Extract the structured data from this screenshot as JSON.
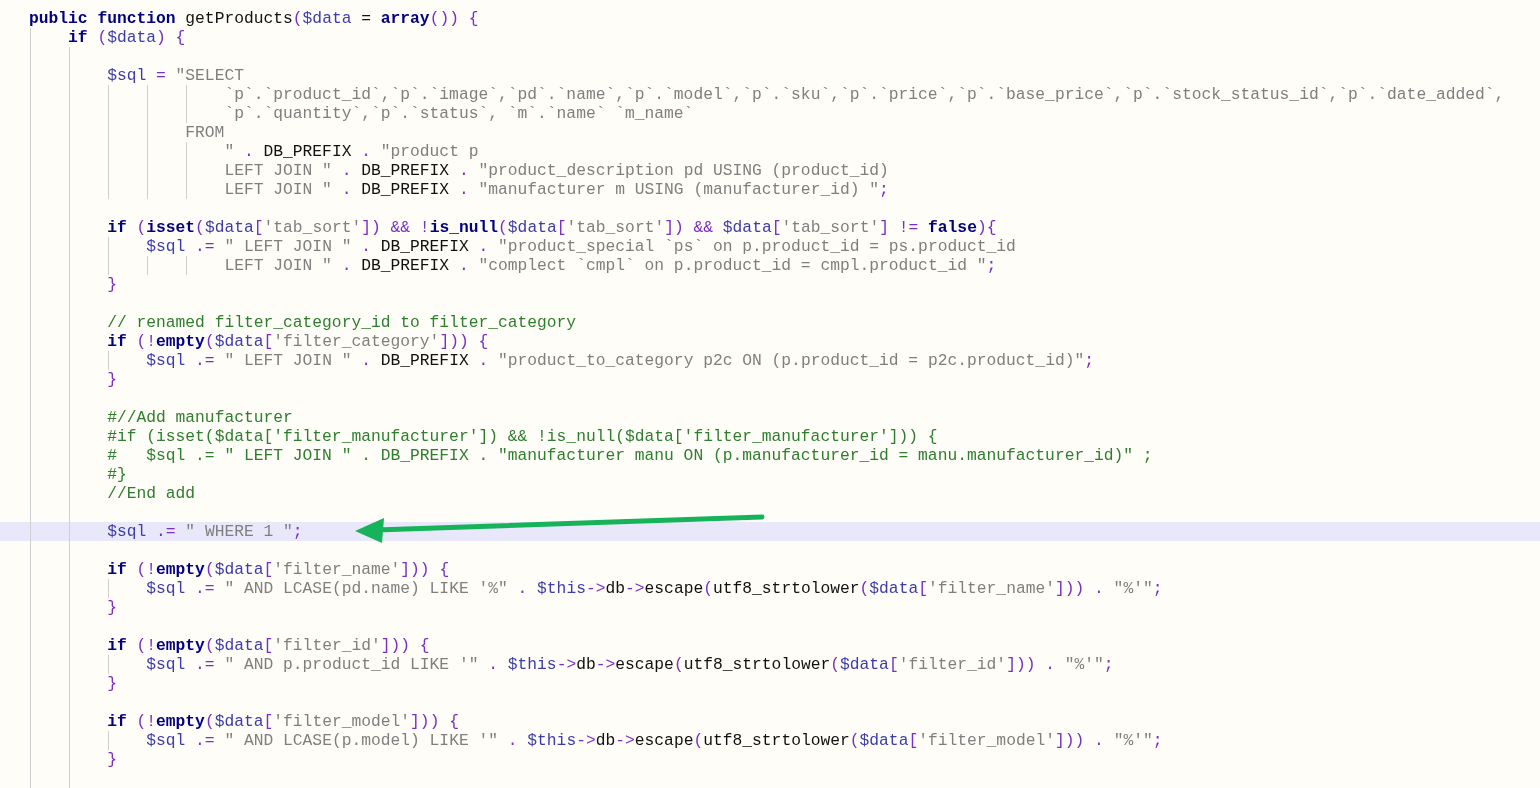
{
  "editor": {
    "lines": [
      {
        "highlighted": false,
        "tokens": [
          {
            "kind": "keyword",
            "text": "public function"
          },
          {
            "kind": "plain",
            "text": " getProducts"
          },
          {
            "kind": "operator",
            "text": "("
          },
          {
            "kind": "variable",
            "text": "$data"
          },
          {
            "kind": "plain",
            "text": " = "
          },
          {
            "kind": "keyword",
            "text": "array"
          },
          {
            "kind": "operator",
            "text": "()) {"
          }
        ],
        "children": [
          {
            "highlighted": false,
            "tokens": [
              {
                "kind": "keyword",
                "text": "if"
              },
              {
                "kind": "operator",
                "text": " ("
              },
              {
                "kind": "variable",
                "text": "$data"
              },
              {
                "kind": "operator",
                "text": ") {"
              }
            ],
            "children": [
              {
                "highlighted": false
              },
              {
                "highlighted": false,
                "tokens": [
                  {
                    "kind": "variable",
                    "text": "$sql"
                  },
                  {
                    "kind": "operator",
                    "text": " = "
                  },
                  {
                    "kind": "string",
                    "text": "\"SELECT"
                  }
                ],
                "children": [
                  {
                    "kind": "wrapped",
                    "highlighted": false,
                    "tokens": [
                      {
                        "kind": "string",
                        "text": "`p`.`product_id`,`p`.`image`,`pd`.`name`,`p`.`model`,`p`.`sku`,`p`.`price`,`p`.`base_price`,`p`.`stock_status_id`,`p`.`date_added`,"
                      }
                    ]
                  },
                  {
                    "kind": "wrapped",
                    "highlighted": false,
                    "tokens": [
                      {
                        "kind": "string",
                        "text": "`p`.`quantity`,`p`.`status`, `m`.`name` `m_name`"
                      }
                    ]
                  },
                  {
                    "kind": "clause",
                    "highlighted": false,
                    "tokens": [
                      {
                        "kind": "string",
                        "text": "FROM"
                      }
                    ]
                  },
                  {
                    "kind": "wrapped",
                    "highlighted": false,
                    "tokens": [
                      {
                        "kind": "string",
                        "text": "\""
                      },
                      {
                        "kind": "operator",
                        "text": " . "
                      },
                      {
                        "kind": "constant",
                        "text": "DB_PREFIX"
                      },
                      {
                        "kind": "operator",
                        "text": " . "
                      },
                      {
                        "kind": "string",
                        "text": "\"product p"
                      }
                    ]
                  },
                  {
                    "kind": "wrapped",
                    "highlighted": false,
                    "tokens": [
                      {
                        "kind": "string",
                        "text": "LEFT JOIN \""
                      },
                      {
                        "kind": "operator",
                        "text": " . "
                      },
                      {
                        "kind": "constant",
                        "text": "DB_PREFIX"
                      },
                      {
                        "kind": "operator",
                        "text": " . "
                      },
                      {
                        "kind": "string",
                        "text": "\"product_description pd USING (product_id)"
                      }
                    ]
                  },
                  {
                    "kind": "wrapped",
                    "highlighted": false,
                    "tokens": [
                      {
                        "kind": "string",
                        "text": "LEFT JOIN \""
                      },
                      {
                        "kind": "operator",
                        "text": " . "
                      },
                      {
                        "kind": "constant",
                        "text": "DB_PREFIX"
                      },
                      {
                        "kind": "operator",
                        "text": " . "
                      },
                      {
                        "kind": "string",
                        "text": "\"manufacturer m USING (manufacturer_id) \""
                      },
                      {
                        "kind": "operator",
                        "text": ";"
                      }
                    ]
                  }
                ]
              },
              {
                "highlighted": false
              },
              {
                "highlighted": false,
                "tokens": [
                  {
                    "kind": "keyword",
                    "text": "if"
                  },
                  {
                    "kind": "operator",
                    "text": " ("
                  },
                  {
                    "kind": "keyword",
                    "text": "isset"
                  },
                  {
                    "kind": "operator",
                    "text": "("
                  },
                  {
                    "kind": "variable",
                    "text": "$data"
                  },
                  {
                    "kind": "operator",
                    "text": "["
                  },
                  {
                    "kind": "string",
                    "text": "'tab_sort'"
                  },
                  {
                    "kind": "operator",
                    "text": "]) && !"
                  },
                  {
                    "kind": "keyword",
                    "text": "is_null"
                  },
                  {
                    "kind": "operator",
                    "text": "("
                  },
                  {
                    "kind": "variable",
                    "text": "$data"
                  },
                  {
                    "kind": "operator",
                    "text": "["
                  },
                  {
                    "kind": "string",
                    "text": "'tab_sort'"
                  },
                  {
                    "kind": "operator",
                    "text": "]) && "
                  },
                  {
                    "kind": "variable",
                    "text": "$data"
                  },
                  {
                    "kind": "operator",
                    "text": "["
                  },
                  {
                    "kind": "string",
                    "text": "'tab_sort'"
                  },
                  {
                    "kind": "operator",
                    "text": "] != "
                  },
                  {
                    "kind": "keyword",
                    "text": "false"
                  },
                  {
                    "kind": "operator",
                    "text": "){"
                  }
                ],
                "children": [
                  {
                    "highlighted": false,
                    "tokens": [
                      {
                        "kind": "variable",
                        "text": "$sql"
                      },
                      {
                        "kind": "operator",
                        "text": " .= "
                      },
                      {
                        "kind": "string",
                        "text": "\" LEFT JOIN \""
                      },
                      {
                        "kind": "operator",
                        "text": " . "
                      },
                      {
                        "kind": "constant",
                        "text": "DB_PREFIX"
                      },
                      {
                        "kind": "operator",
                        "text": " . "
                      },
                      {
                        "kind": "string",
                        "text": "\"product_special `ps` on p.product_id = ps.product_id"
                      }
                    ],
                    "children": [
                      {
                        "kind": "wrapped",
                        "highlighted": false,
                        "tokens": [
                          {
                            "kind": "string",
                            "text": "LEFT JOIN \""
                          },
                          {
                            "kind": "operator",
                            "text": " . "
                          },
                          {
                            "kind": "constant",
                            "text": "DB_PREFIX"
                          },
                          {
                            "kind": "operator",
                            "text": " . "
                          },
                          {
                            "kind": "string",
                            "text": "\"complect `cmpl` on p.product_id = cmpl.product_id \""
                          },
                          {
                            "kind": "operator",
                            "text": ";"
                          }
                        ]
                      }
                    ]
                  }
                ]
              },
              {
                "highlighted": false,
                "tokens": [
                  {
                    "kind": "operator",
                    "text": "}"
                  }
                ]
              },
              {
                "highlighted": false
              },
              {
                "highlighted": false,
                "tokens": [
                  {
                    "kind": "comment",
                    "text": "// renamed filter_category_id to filter_category"
                  }
                ]
              },
              {
                "highlighted": false,
                "tokens": [
                  {
                    "kind": "keyword",
                    "text": "if"
                  },
                  {
                    "kind": "operator",
                    "text": " (!"
                  },
                  {
                    "kind": "keyword",
                    "text": "empty"
                  },
                  {
                    "kind": "operator",
                    "text": "("
                  },
                  {
                    "kind": "variable",
                    "text": "$data"
                  },
                  {
                    "kind": "operator",
                    "text": "["
                  },
                  {
                    "kind": "string",
                    "text": "'filter_category'"
                  },
                  {
                    "kind": "operator",
                    "text": "])) {"
                  }
                ],
                "children": [
                  {
                    "highlighted": false,
                    "tokens": [
                      {
                        "kind": "variable",
                        "text": "$sql"
                      },
                      {
                        "kind": "operator",
                        "text": " .= "
                      },
                      {
                        "kind": "string",
                        "text": "\" LEFT JOIN \""
                      },
                      {
                        "kind": "operator",
                        "text": " . "
                      },
                      {
                        "kind": "constant",
                        "text": "DB_PREFIX"
                      },
                      {
                        "kind": "operator",
                        "text": " . "
                      },
                      {
                        "kind": "string",
                        "text": "\"product_to_category p2c ON (p.product_id = p2c.product_id)\""
                      },
                      {
                        "kind": "operator",
                        "text": ";"
                      }
                    ]
                  }
                ]
              },
              {
                "highlighted": false,
                "tokens": [
                  {
                    "kind": "operator",
                    "text": "}"
                  }
                ]
              },
              {
                "highlighted": false
              },
              {
                "highlighted": false,
                "tokens": [
                  {
                    "kind": "comment",
                    "text": "#//Add manufacturer"
                  }
                ]
              },
              {
                "highlighted": false,
                "tokens": [
                  {
                    "kind": "comment",
                    "text": "#if (isset($data['filter_manufacturer']) && !is_null($data['filter_manufacturer'])) {"
                  }
                ]
              },
              {
                "highlighted": false,
                "tokens": [
                  {
                    "kind": "comment",
                    "text": "#   $sql .= \" LEFT JOIN \" . DB_PREFIX . \"manufacturer manu ON (p.manufacturer_id = manu.manufacturer_id)\" ;"
                  }
                ]
              },
              {
                "highlighted": false,
                "tokens": [
                  {
                    "kind": "comment",
                    "text": "#}"
                  }
                ]
              },
              {
                "highlighted": false,
                "tokens": [
                  {
                    "kind": "comment",
                    "text": "//End add"
                  }
                ]
              },
              {
                "highlighted": false
              },
              {
                "highlighted": true,
                "tokens": [
                  {
                    "kind": "variable",
                    "text": "$sql"
                  },
                  {
                    "kind": "operator",
                    "text": " .= "
                  },
                  {
                    "kind": "string",
                    "text": "\" WHERE 1 \""
                  },
                  {
                    "kind": "operator",
                    "text": ";"
                  }
                ]
              },
              {
                "highlighted": false
              },
              {
                "highlighted": false,
                "tokens": [
                  {
                    "kind": "keyword",
                    "text": "if"
                  },
                  {
                    "kind": "operator",
                    "text": " (!"
                  },
                  {
                    "kind": "keyword",
                    "text": "empty"
                  },
                  {
                    "kind": "operator",
                    "text": "("
                  },
                  {
                    "kind": "variable",
                    "text": "$data"
                  },
                  {
                    "kind": "operator",
                    "text": "["
                  },
                  {
                    "kind": "string",
                    "text": "'filter_name'"
                  },
                  {
                    "kind": "operator",
                    "text": "])) {"
                  }
                ],
                "children": [
                  {
                    "highlighted": false,
                    "tokens": [
                      {
                        "kind": "variable",
                        "text": "$sql"
                      },
                      {
                        "kind": "operator",
                        "text": " .= "
                      },
                      {
                        "kind": "string",
                        "text": "\" AND LCASE(pd.name) LIKE '%\""
                      },
                      {
                        "kind": "operator",
                        "text": " . "
                      },
                      {
                        "kind": "variable",
                        "text": "$this"
                      },
                      {
                        "kind": "operator",
                        "text": "->"
                      },
                      {
                        "kind": "constant",
                        "text": "db"
                      },
                      {
                        "kind": "operator",
                        "text": "->"
                      },
                      {
                        "kind": "constant",
                        "text": "escape"
                      },
                      {
                        "kind": "operator",
                        "text": "("
                      },
                      {
                        "kind": "constant",
                        "text": "utf8_strtolower"
                      },
                      {
                        "kind": "operator",
                        "text": "("
                      },
                      {
                        "kind": "variable",
                        "text": "$data"
                      },
                      {
                        "kind": "operator",
                        "text": "["
                      },
                      {
                        "kind": "string",
                        "text": "'filter_name'"
                      },
                      {
                        "kind": "operator",
                        "text": "])) . "
                      },
                      {
                        "kind": "string",
                        "text": "\"%'\""
                      },
                      {
                        "kind": "operator",
                        "text": ";"
                      }
                    ]
                  }
                ]
              },
              {
                "highlighted": false,
                "tokens": [
                  {
                    "kind": "operator",
                    "text": "}"
                  }
                ]
              },
              {
                "highlighted": false
              },
              {
                "highlighted": false,
                "tokens": [
                  {
                    "kind": "keyword",
                    "text": "if"
                  },
                  {
                    "kind": "operator",
                    "text": " (!"
                  },
                  {
                    "kind": "keyword",
                    "text": "empty"
                  },
                  {
                    "kind": "operator",
                    "text": "("
                  },
                  {
                    "kind": "variable",
                    "text": "$data"
                  },
                  {
                    "kind": "operator",
                    "text": "["
                  },
                  {
                    "kind": "string",
                    "text": "'filter_id'"
                  },
                  {
                    "kind": "operator",
                    "text": "])) {"
                  }
                ],
                "children": [
                  {
                    "highlighted": false,
                    "tokens": [
                      {
                        "kind": "variable",
                        "text": "$sql"
                      },
                      {
                        "kind": "operator",
                        "text": " .= "
                      },
                      {
                        "kind": "string",
                        "text": "\" AND p.product_id LIKE '\""
                      },
                      {
                        "kind": "operator",
                        "text": " . "
                      },
                      {
                        "kind": "variable",
                        "text": "$this"
                      },
                      {
                        "kind": "operator",
                        "text": "->"
                      },
                      {
                        "kind": "constant",
                        "text": "db"
                      },
                      {
                        "kind": "operator",
                        "text": "->"
                      },
                      {
                        "kind": "constant",
                        "text": "escape"
                      },
                      {
                        "kind": "operator",
                        "text": "("
                      },
                      {
                        "kind": "constant",
                        "text": "utf8_strtolower"
                      },
                      {
                        "kind": "operator",
                        "text": "("
                      },
                      {
                        "kind": "variable",
                        "text": "$data"
                      },
                      {
                        "kind": "operator",
                        "text": "["
                      },
                      {
                        "kind": "string",
                        "text": "'filter_id'"
                      },
                      {
                        "kind": "operator",
                        "text": "])) . "
                      },
                      {
                        "kind": "string",
                        "text": "\"%'\""
                      },
                      {
                        "kind": "operator",
                        "text": ";"
                      }
                    ]
                  }
                ]
              },
              {
                "highlighted": false,
                "tokens": [
                  {
                    "kind": "operator",
                    "text": "}"
                  }
                ]
              },
              {
                "highlighted": false
              },
              {
                "highlighted": false,
                "tokens": [
                  {
                    "kind": "keyword",
                    "text": "if"
                  },
                  {
                    "kind": "operator",
                    "text": " (!"
                  },
                  {
                    "kind": "keyword",
                    "text": "empty"
                  },
                  {
                    "kind": "operator",
                    "text": "("
                  },
                  {
                    "kind": "variable",
                    "text": "$data"
                  },
                  {
                    "kind": "operator",
                    "text": "["
                  },
                  {
                    "kind": "string",
                    "text": "'filter_model'"
                  },
                  {
                    "kind": "operator",
                    "text": "])) {"
                  }
                ],
                "children": [
                  {
                    "highlighted": false,
                    "tokens": [
                      {
                        "kind": "variable",
                        "text": "$sql"
                      },
                      {
                        "kind": "operator",
                        "text": " .= "
                      },
                      {
                        "kind": "string",
                        "text": "\" AND LCASE(p.model) LIKE '\""
                      },
                      {
                        "kind": "operator",
                        "text": " . "
                      },
                      {
                        "kind": "variable",
                        "text": "$this"
                      },
                      {
                        "kind": "operator",
                        "text": "->"
                      },
                      {
                        "kind": "constant",
                        "text": "db"
                      },
                      {
                        "kind": "operator",
                        "text": "->"
                      },
                      {
                        "kind": "constant",
                        "text": "escape"
                      },
                      {
                        "kind": "operator",
                        "text": "("
                      },
                      {
                        "kind": "constant",
                        "text": "utf8_strtolower"
                      },
                      {
                        "kind": "operator",
                        "text": "("
                      },
                      {
                        "kind": "variable",
                        "text": "$data"
                      },
                      {
                        "kind": "operator",
                        "text": "["
                      },
                      {
                        "kind": "string",
                        "text": "'filter_model'"
                      },
                      {
                        "kind": "operator",
                        "text": "])) . "
                      },
                      {
                        "kind": "string",
                        "text": "\"%'\""
                      },
                      {
                        "kind": "operator",
                        "text": ";"
                      }
                    ]
                  }
                ]
              },
              {
                "highlighted": false,
                "tokens": [
                  {
                    "kind": "operator",
                    "text": "}"
                  }
                ]
              },
              {
                "highlighted": false
              }
            ]
          }
        ]
      }
    ]
  }
}
